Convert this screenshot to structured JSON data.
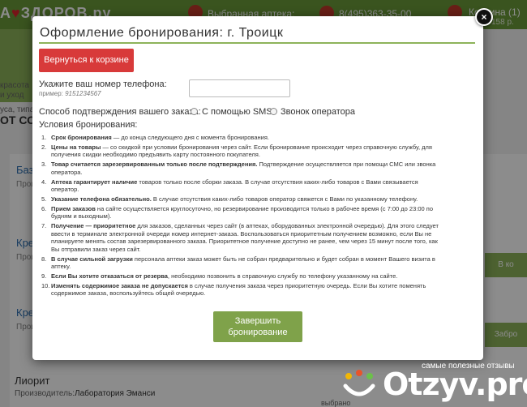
{
  "background": {
    "logo": {
      "prefix": "А",
      "rest": "ЗДОРОВ.ру"
    },
    "pharmacy_label": "Выбранная аптека:",
    "phone": "8(495)363-35-00",
    "cart": {
      "label": "Корзина (1)",
      "sum": "158 р."
    },
    "side_text_1": "красота",
    "side_text_2": "и уход",
    "side_text_3": "уса, типа",
    "section_title": "ОТ СОЛ",
    "rows": [
      {
        "title": "Баз",
        "sub": "Прои"
      },
      {
        "title": "Кре",
        "sub": "Прои"
      },
      {
        "title": "Кре",
        "sub": "Прои"
      }
    ],
    "row_buttons": [
      "В ко",
      "Забро"
    ],
    "footer": {
      "title": "Лиорит",
      "maker_label": "Производитель:",
      "maker": "Лаборатория Эманси",
      "extra": "выбрано"
    }
  },
  "modal": {
    "title": "Оформление бронирования:  г. Троицк",
    "back_button": "Вернуться к корзине",
    "phone_label": "Укажите ваш номер телефона:",
    "phone_example_prefix": "пример:",
    "phone_example_value": "9151234567",
    "phone_value": "",
    "confirm_label": "Способ подтверждения вашего заказа:",
    "confirm_options": [
      "С помощью SMS",
      "Звонок оператора"
    ],
    "conditions_title": "Условия бронирования:",
    "terms": [
      {
        "num": "1.",
        "bold": "Срок бронирования",
        "text": " — до конца следующего дня с момента бронирования."
      },
      {
        "num": "2.",
        "bold": "Цены на товары",
        "text": " — со скидкой при условии бронирования через сайт. Если бронирование происходит через справочную службу, для получения скидки необходимо предъявить карту постоянного покупателя."
      },
      {
        "num": "3.",
        "bold": "Товар считается зарезервированным только после подтверждения.",
        "text": " Подтверждение осуществляется при помощи СМС или звонка оператора."
      },
      {
        "num": "4.",
        "bold": "Аптека гарантирует наличие",
        "text": " товаров только после сборки заказа. В случае отсутствия каких-либо товаров с Вами связывается оператор."
      },
      {
        "num": "5.",
        "bold": "Указание телефона обязательно.",
        "text": " В случае отсутствия каких-либо товаров оператор свяжется с Вами по указанному телефону."
      },
      {
        "num": "6.",
        "bold": "Прием заказов",
        "text": " на сайте осуществляется круглосуточно, но резервирование производится только в рабочее время (с 7:00 до 23:00 по будням и выходным)."
      },
      {
        "num": "7.",
        "bold": "Получение — приоритетное",
        "text": " для заказов, сделанных через сайт (в аптеках, оборудованных электронной очередью). Для этого следует ввести в терминале электронной очереди номер интернет-заказа. Воспользоваться приоритетным получением возможно, если Вы не планируете менять состав зарезервированного заказа. Приоритетное получение доступно не ранее, чем через 15 минут после того, как Вы отправили заказ через сайт."
      },
      {
        "num": "8.",
        "bold": "В случае сильной загрузки",
        "text": " персонала аптеки заказ может быть не собран предварительно и будет собран в момент Вашего визита в аптеку."
      },
      {
        "num": "9.",
        "bold": "Если Вы хотите отказаться от резерва",
        "text": ", необходимо позвонить в справочную службу по телефону указанному на сайте."
      },
      {
        "num": "10.",
        "bold": "Изменять содержимое заказа не допускается",
        "text": " в случае получения заказа через приоритетную очередь. Если Вы хотите поменять содержимое заказа, воспользуйтесь общей очередью."
      }
    ],
    "finish_button_line1": "Завершить",
    "finish_button_line2": "бронирование",
    "close_symbol": "×"
  },
  "watermark": {
    "caption": "самые полезные отзывы",
    "brand": "Otzyv.pro"
  },
  "colors": {
    "accent_green": "#8db35a",
    "button_red": "#d83a3a",
    "button_green": "#7fa24a"
  }
}
